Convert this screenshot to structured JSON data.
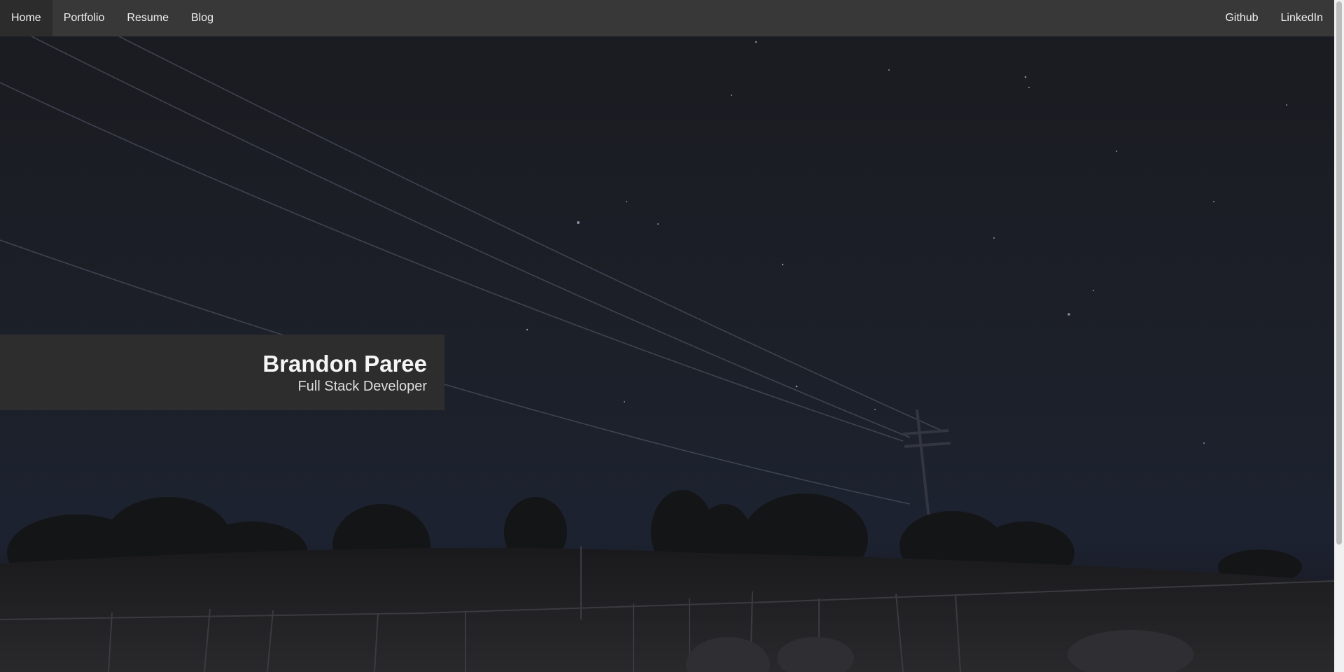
{
  "nav": {
    "left_items": [
      {
        "label": "Home",
        "active": true
      },
      {
        "label": "Portfolio",
        "active": false
      },
      {
        "label": "Resume",
        "active": false
      },
      {
        "label": "Blog",
        "active": false
      }
    ],
    "right_items": [
      {
        "label": "Github"
      },
      {
        "label": "LinkedIn"
      }
    ]
  },
  "hero": {
    "name": "Brandon Paree",
    "role": "Full Stack Developer"
  },
  "colors": {
    "navbar_bg": "#383838",
    "navbar_active_bg": "#2c2c2c",
    "card_bg": "#2d2d2d",
    "sky_top": "#1b1c21",
    "sky_bottom": "#1f2330",
    "text": "#f5f5f5"
  }
}
